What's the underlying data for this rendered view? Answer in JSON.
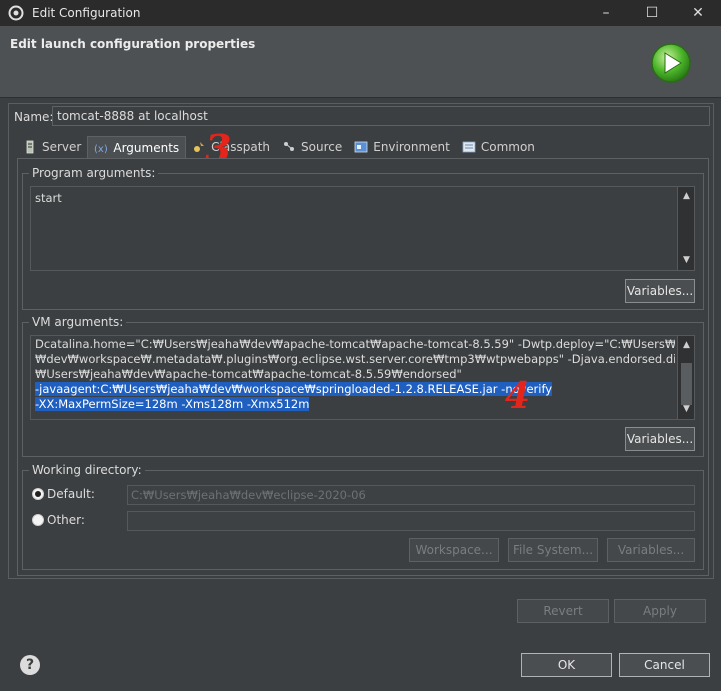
{
  "window": {
    "title": "Edit Configuration",
    "icon": "eclipse-gear-icon",
    "controls": [
      "–",
      "☐",
      "✕"
    ]
  },
  "header": {
    "title": "Edit launch configuration properties",
    "icon": "run-icon"
  },
  "name": {
    "label": "Name:",
    "value": "tomcat-8888 at localhost"
  },
  "tabs": [
    {
      "label": "Server",
      "icon": "server-icon"
    },
    {
      "label": "Arguments",
      "icon": "arguments-icon",
      "active": true
    },
    {
      "label": "Classpath",
      "icon": "classpath-icon"
    },
    {
      "label": "Source",
      "icon": "source-icon"
    },
    {
      "label": "Environment",
      "icon": "environment-icon"
    },
    {
      "label": "Common",
      "icon": "common-icon"
    }
  ],
  "program_args": {
    "title": "Program arguments:",
    "value": "start",
    "variables_label": "Variables..."
  },
  "vm_args": {
    "title": "VM arguments:",
    "line1": "Dcatalina.home=\"C:₩Users₩jeaha₩dev₩apache-tomcat₩apache-tomcat-8.5.59\" -Dwtp.deploy=\"C:₩Users₩jeaha",
    "line2": "₩dev₩workspace₩.metadata₩.plugins₩org.eclipse.wst.server.core₩tmp3₩wtpwebapps\" -Djava.endorsed.dirs=\"C:",
    "line3": "₩Users₩jeaha₩dev₩apache-tomcat₩apache-tomcat-8.5.59₩endorsed\"",
    "line4": "-javaagent:C:₩Users₩jeaha₩dev₩workspace₩springloaded-1.2.8.RELEASE.jar -noverify",
    "line5": "-XX:MaxPermSize=128m -Xms128m -Xmx512m",
    "variables_label": "Variables..."
  },
  "working_dir": {
    "title": "Working directory:",
    "default_label": "Default:",
    "default_value": "C:₩Users₩jeaha₩dev₩eclipse-2020-06",
    "other_label": "Other:",
    "other_value": "",
    "workspace_label": "Workspace...",
    "filesystem_label": "File System...",
    "variables_label": "Variables..."
  },
  "actions": {
    "revert": "Revert",
    "apply": "Apply",
    "ok": "OK",
    "cancel": "Cancel"
  },
  "annotations": {
    "tab_marker": "3",
    "vm_marker": "4"
  },
  "colors": {
    "accent_selection": "#1f5fbf",
    "annotation_red": "#e3251c"
  }
}
